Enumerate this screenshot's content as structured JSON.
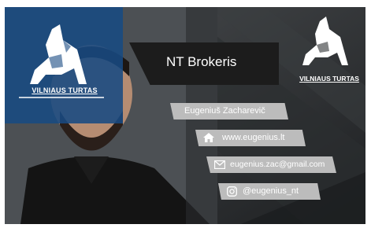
{
  "title": "NT Brokeris",
  "name": "Eugeniuš Zacharevič",
  "contacts": [
    {
      "icon": "home-icon",
      "text": "www.eugenius.lt"
    },
    {
      "icon": "mail-icon",
      "text": "eugenius.zac@gmail.com"
    },
    {
      "icon": "instagram-icon",
      "text": "@eugenius_nt"
    }
  ],
  "logo_text": "VILNIAUS TURTAS",
  "colors": {
    "accent_blue": "#184a82",
    "dark_panel": "#1c1c1c",
    "strip_gray": "#bcbcbc"
  }
}
